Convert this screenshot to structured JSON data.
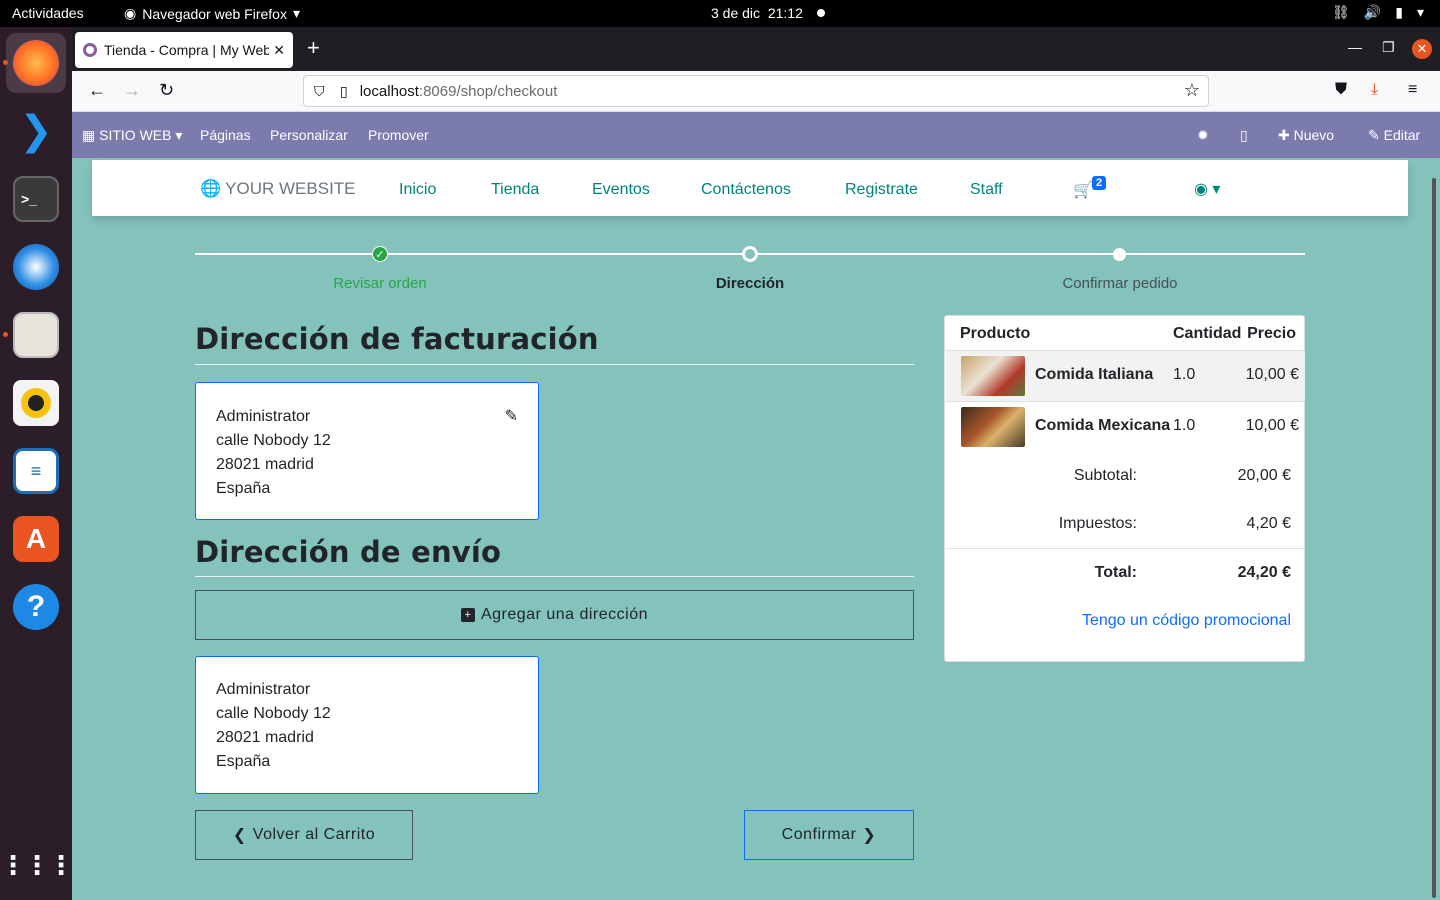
{
  "system": {
    "activities": "Actividades",
    "app_name": "Navegador web Firefox",
    "date": "3 de dic",
    "time": "21:12"
  },
  "browser": {
    "tab_title": "Tienda - Compra | My Website",
    "url_host": "localhost",
    "url_rest": ":8069/shop/checkout"
  },
  "odoo_bar": {
    "apps": "SITIO WEB",
    "pages": "Páginas",
    "customize": "Personalizar",
    "promote": "Promover",
    "new": "Nuevo",
    "edit": "Editar"
  },
  "site": {
    "logo": "YOUR WEBSITE",
    "nav": [
      "Inicio",
      "Tienda",
      "Eventos",
      "Contáctenos",
      "Registrate",
      "Staff"
    ],
    "cart_count": "2"
  },
  "progress": {
    "steps": [
      "Revisar orden",
      "Dirección",
      "Confirmar pedido"
    ],
    "current": 1
  },
  "billing": {
    "heading": "Dirección de facturación",
    "lines": [
      "Administrator",
      "calle Nobody 12",
      "28021 madrid",
      "España"
    ]
  },
  "shipping": {
    "heading": "Dirección de envío",
    "add_label": "Agregar una dirección",
    "lines": [
      "Administrator",
      "calle Nobody 12",
      "28021 madrid",
      "España"
    ]
  },
  "actions": {
    "back": "Volver al Carrito",
    "confirm": "Confirmar"
  },
  "summary": {
    "col_product": "Producto",
    "col_qty": "Cantidad",
    "col_price": "Precio",
    "items": [
      {
        "name": "Comida Italiana",
        "qty": "1.0",
        "price": "10,00 €"
      },
      {
        "name": "Comida Mexicana",
        "qty": "1.0",
        "price": "10,00 €"
      }
    ],
    "subtotal_label": "Subtotal:",
    "subtotal": "20,00 €",
    "taxes_label": "Impuestos:",
    "taxes": "4,20 €",
    "total_label": "Total:",
    "total": "24,20 €",
    "promo": "Tengo un código promocional"
  },
  "colors": {
    "accent": "#00837c",
    "odoo_bar": "#7c7bad",
    "page_bg": "#84c2bc",
    "success": "#28a745",
    "link": "#0d6efd"
  }
}
